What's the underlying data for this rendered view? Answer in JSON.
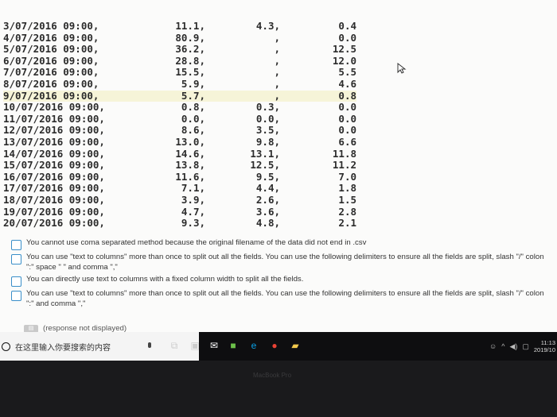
{
  "table": {
    "rows": [
      {
        "date": "3/07/2016 09:00,",
        "a": "11.1,",
        "b": "4.3,",
        "c": "0.4"
      },
      {
        "date": "4/07/2016 09:00,",
        "a": "80.9,",
        "b": ",",
        "c": "0.0"
      },
      {
        "date": "5/07/2016 09:00,",
        "a": "36.2,",
        "b": ",",
        "c": "12.5"
      },
      {
        "date": "6/07/2016 09:00,",
        "a": "28.8,",
        "b": ",",
        "c": "12.0"
      },
      {
        "date": "7/07/2016 09:00,",
        "a": "15.5,",
        "b": ",",
        "c": "5.5"
      },
      {
        "date": "8/07/2016 09:00,",
        "a": "5.9,",
        "b": ",",
        "c": "4.6"
      },
      {
        "date": "9/07/2016 09:00,",
        "a": "5.7,",
        "b": ",",
        "c": "0.8",
        "highlight": true
      },
      {
        "date": "10/07/2016 09:00,",
        "a": "0.8,",
        "b": "0.3,",
        "c": "0.0"
      },
      {
        "date": "11/07/2016 09:00,",
        "a": "0.0,",
        "b": "0.0,",
        "c": "0.0"
      },
      {
        "date": "12/07/2016 09:00,",
        "a": "8.6,",
        "b": "3.5,",
        "c": "0.0"
      },
      {
        "date": "13/07/2016 09:00,",
        "a": "13.0,",
        "b": "9.8,",
        "c": "6.6"
      },
      {
        "date": "14/07/2016 09:00,",
        "a": "14.6,",
        "b": "13.1,",
        "c": "11.8"
      },
      {
        "date": "15/07/2016 09:00,",
        "a": "13.8,",
        "b": "12.5,",
        "c": "11.2"
      },
      {
        "date": "16/07/2016 09:00,",
        "a": "11.6,",
        "b": "9.5,",
        "c": "7.0"
      },
      {
        "date": "17/07/2016 09:00,",
        "a": "7.1,",
        "b": "4.4,",
        "c": "1.8"
      },
      {
        "date": "18/07/2016 09:00,",
        "a": "3.9,",
        "b": "2.6,",
        "c": "1.5"
      },
      {
        "date": "19/07/2016 09:00,",
        "a": "4.7,",
        "b": "3.6,",
        "c": "2.8"
      },
      {
        "date": "20/07/2016 09:00,",
        "a": "9.3,",
        "b": "4.8,",
        "c": "2.1"
      }
    ]
  },
  "options": [
    "You cannot use coma separated method because the original filename of the data did not end in .csv",
    "You can use \"text to columns\" more than once to split out all the fields. You can use the following delimiters to ensure all the fields are split, slash \"/\" colon \":\" space \" \" and comma \",\"",
    "You can directly use text to columns with a fixed column width to split all the fields.",
    "You can use \"text to columns\" more than once to split out all the fields. You can use the following delimiters to ensure all the fields are split, slash \"/\" colon \":\" and comma \",\""
  ],
  "response": {
    "text": "(response not displayed)"
  },
  "taskbar": {
    "search_placeholder": "在这里输入你要搜索的内容",
    "clock_time": "11:13",
    "clock_date": "2019/10"
  },
  "bezel": {
    "label": "MacBook Pro"
  },
  "icons": [
    "cursor-icon",
    "cortana-icon",
    "microphone-icon",
    "task-view-icon",
    "store-icon",
    "mail-icon",
    "edge-icon",
    "chrome-icon",
    "file-explorer-icon",
    "people-icon",
    "chevron-up-icon",
    "volume-icon",
    "notification-icon"
  ]
}
